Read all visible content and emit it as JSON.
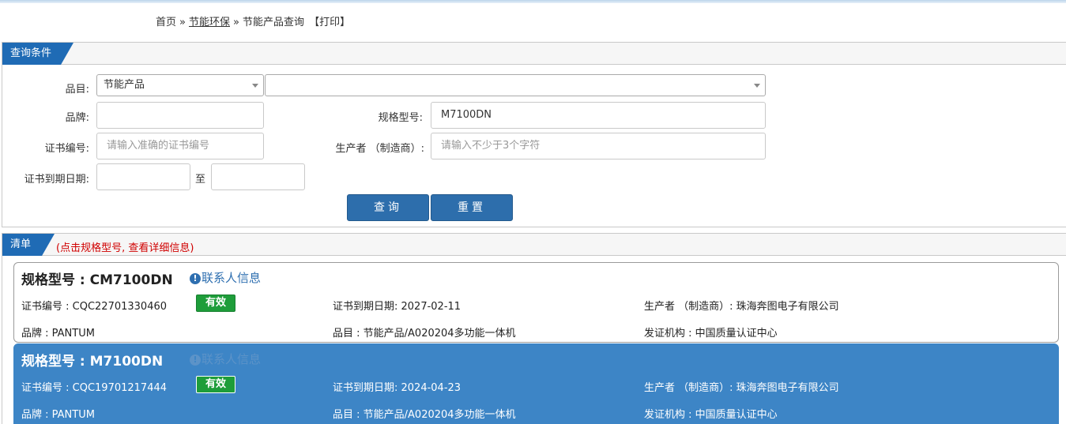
{
  "breadcrumb": {
    "home": "首页",
    "sep1": "»",
    "section": "节能环保",
    "sep2": "»",
    "current": "节能产品查询",
    "print": "【打印】"
  },
  "query": {
    "panel_title": "查询条件",
    "category_label": "品目:",
    "category_value": "节能产品",
    "subcategory_value": "",
    "brand_label": "品牌:",
    "brand_value": "",
    "model_label": "规格型号:",
    "model_value": "M7100DN",
    "cert_label": "证书编号:",
    "cert_placeholder": "请输入准确的证书编号",
    "maker_label": "生产者 （制造商）:",
    "maker_placeholder": "请输入不少于3个字符",
    "expiry_label": "证书到期日期:",
    "expiry_from": "",
    "expiry_to_label": "至",
    "expiry_to": "",
    "search_button": "查询",
    "reset_button": "重置"
  },
  "list": {
    "panel_title": "清单",
    "hint": "(点击规格型号, 查看详细信息)",
    "items": [
      {
        "model": "规格型号 : CM7100DN",
        "contact": "联系人信息",
        "cert_no": "证书编号 : CQC22701330460",
        "status": "有效",
        "expiry": "证书到期日期: 2027-02-11",
        "maker": "生产者 （制造商）: 珠海奔图电子有限公司",
        "brand": "品牌 : PANTUM",
        "category": "品目 : 节能产品/A020204多功能一体机",
        "issuer": "发证机构 : 中国质量认证中心"
      },
      {
        "model": "规格型号 : M7100DN",
        "contact": "联系人信息",
        "cert_no": "证书编号 : CQC19701217444",
        "status": "有效",
        "expiry": "证书到期日期: 2024-04-23",
        "maker": "生产者 （制造商）: 珠海奔图电子有限公司",
        "brand": "品牌 : PANTUM",
        "category": "品目 : 节能产品/A020204多功能一体机",
        "issuer": "发证机构 : 中国质量认证中心"
      }
    ]
  },
  "colors": {
    "tab_blue": "#1f6bb5",
    "button_blue": "#2d6eac",
    "selected_row": "#3d85c6",
    "valid_green": "#1e9d3a",
    "hint_red": "#d00000"
  }
}
